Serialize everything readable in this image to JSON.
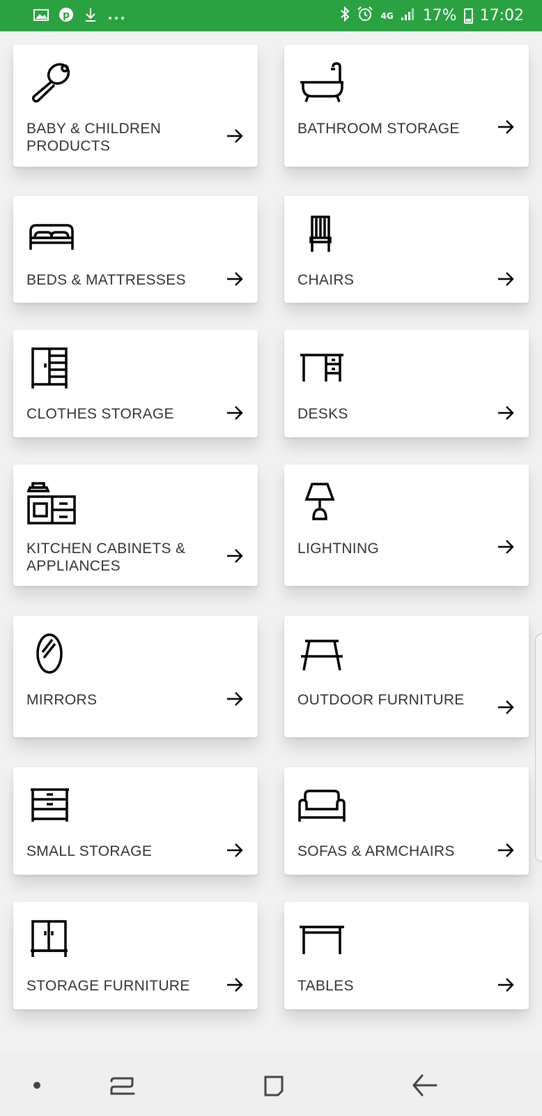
{
  "status_bar": {
    "icons_left": [
      "gallery-icon",
      "pinterest-icon",
      "download-icon",
      "more-dots-icon"
    ],
    "network": "4G",
    "battery": "17%",
    "time": "17:02"
  },
  "categories": [
    {
      "label": "BABY & CHILDREN PRODUCTS",
      "icon": "rattle-icon"
    },
    {
      "label": "BATHROOM STORAGE",
      "icon": "bathtub-icon"
    },
    {
      "label": "BEDS & MATTRESSES",
      "icon": "bed-icon"
    },
    {
      "label": "CHAIRS",
      "icon": "chair-icon"
    },
    {
      "label": "CLOTHES STORAGE",
      "icon": "wardrobe-icon"
    },
    {
      "label": "DESKS",
      "icon": "desk-icon"
    },
    {
      "label": "KITCHEN CABINETS & APPLIANCES",
      "icon": "kitchen-icon"
    },
    {
      "label": "LIGHTNING",
      "icon": "lamp-icon"
    },
    {
      "label": "MIRRORS",
      "icon": "mirror-icon"
    },
    {
      "label": "OUTDOOR FURNITURE",
      "icon": "picnic-table-icon"
    },
    {
      "label": "SMALL STORAGE",
      "icon": "drawers-icon"
    },
    {
      "label": "SOFAS & ARMCHAIRS",
      "icon": "sofa-icon"
    },
    {
      "label": "STORAGE FURNITURE",
      "icon": "cabinet-icon"
    },
    {
      "label": "TABLES",
      "icon": "table-icon"
    }
  ],
  "nav_bar": {
    "icons": [
      "dot-icon",
      "recent-apps-icon",
      "home-icon",
      "back-icon"
    ]
  },
  "colors": {
    "status_bar": "#2aa241",
    "card": "#ffffff",
    "background": "#f1f1f1",
    "text": "#333333"
  }
}
